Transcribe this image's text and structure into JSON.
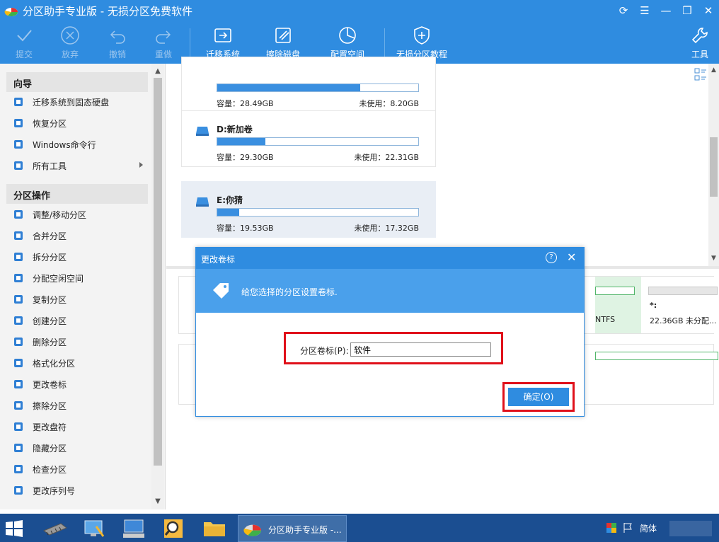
{
  "app": {
    "title": "分区助手专业版 - 无损分区免费软件"
  },
  "toolbar": {
    "commit": "提交",
    "discard": "放弃",
    "undo": "撤销",
    "redo": "重做",
    "migrate_os": "迁移系统",
    "wipe_disk": "擦除磁盘",
    "allocate_space": "配置空间",
    "tutorial": "无损分区教程",
    "tools": "工具"
  },
  "sidebar": {
    "wizard_title": "向导",
    "wizard_items": [
      {
        "label": "迁移系统到固态硬盘",
        "icon": "migrate-ssd-icon"
      },
      {
        "label": "恢复分区",
        "icon": "recover-icon"
      },
      {
        "label": "Windows命令行",
        "icon": "windows-icon"
      },
      {
        "label": "所有工具",
        "icon": "all-tools-icon"
      }
    ],
    "ops_title": "分区操作",
    "ops_items": [
      {
        "label": "调整/移动分区",
        "icon": "resize-icon"
      },
      {
        "label": "合并分区",
        "icon": "merge-icon"
      },
      {
        "label": "拆分分区",
        "icon": "split-icon"
      },
      {
        "label": "分配空闲空间",
        "icon": "allocate-icon"
      },
      {
        "label": "复制分区",
        "icon": "copy-icon"
      },
      {
        "label": "创建分区",
        "icon": "create-icon"
      },
      {
        "label": "删除分区",
        "icon": "delete-icon"
      },
      {
        "label": "格式化分区",
        "icon": "format-icon"
      },
      {
        "label": "更改卷标",
        "icon": "label-icon"
      },
      {
        "label": "擦除分区",
        "icon": "wipe-icon"
      },
      {
        "label": "更改盘符",
        "icon": "drive-letter-icon"
      },
      {
        "label": "隐藏分区",
        "icon": "hide-icon"
      },
      {
        "label": "检查分区",
        "icon": "check-icon"
      },
      {
        "label": "更改序列号",
        "icon": "serial-icon"
      }
    ]
  },
  "partitions": [
    {
      "name": "",
      "capacity": "容量：28.49GB",
      "unused": "未使用：8.20GB",
      "used_fraction": 0.71
    },
    {
      "name": "D:新加卷",
      "capacity": "容量：29.30GB",
      "unused": "未使用：22.31GB",
      "used_fraction": 0.24
    },
    {
      "name": "E:你猜",
      "capacity": "容量：19.53GB",
      "unused": "未使用：17.32GB",
      "used_fraction": 0.11
    }
  ],
  "disk_map": {
    "ntfs_label": "NTFS",
    "unalloc_name": "*:",
    "unalloc_text": "22.36GB 未分配..."
  },
  "dialog": {
    "title": "更改卷标",
    "message": "给您选择的分区设置卷标.",
    "field_label": "分区卷标(P):",
    "field_value": "软件",
    "ok": "确定(O)"
  },
  "taskbar": {
    "active_app": "分区助手专业版 -...",
    "language": "简体"
  },
  "colors": {
    "accent": "#2f8ce0",
    "highlight_border": "#e0101a"
  }
}
